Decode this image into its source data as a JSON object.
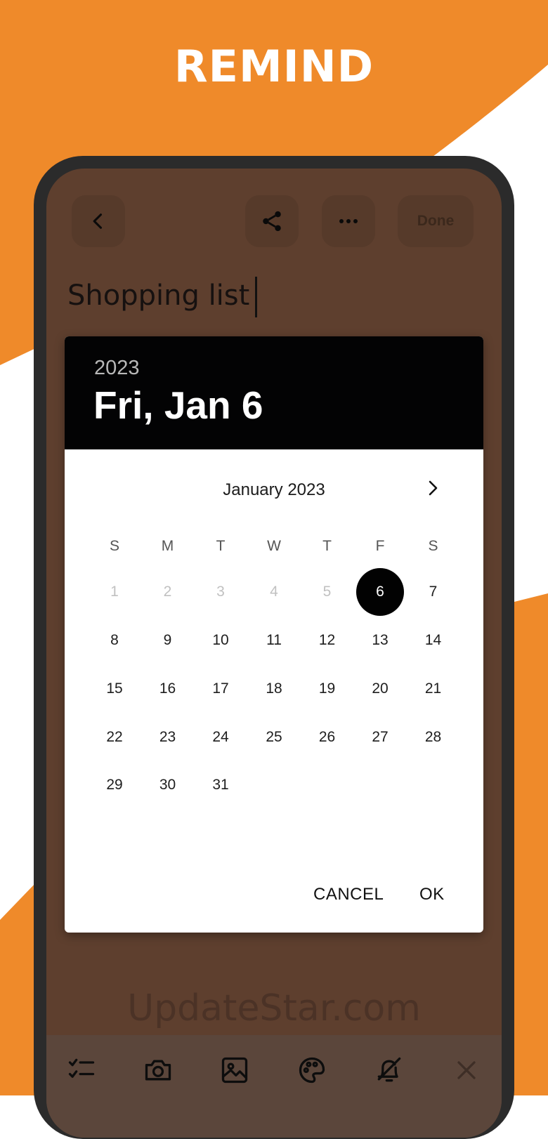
{
  "headline": "REMIND",
  "colors": {
    "brand_orange": "#EF8A2A",
    "screen_brown": "#5E3F2E",
    "selected_day": "#020202"
  },
  "toolbar": {
    "back_icon": "chevron-left-icon",
    "share_icon": "share-icon",
    "more_icon": "more-horizontal-icon",
    "done_label": "Done"
  },
  "note": {
    "title": "Shopping list"
  },
  "date_picker": {
    "year": "2023",
    "selected_date": "Fri, Jan 6",
    "month_label": "January 2023",
    "weekdays": [
      "S",
      "M",
      "T",
      "W",
      "T",
      "F",
      "S"
    ],
    "days": [
      "1",
      "2",
      "3",
      "4",
      "5",
      "6",
      "7",
      "8",
      "9",
      "10",
      "11",
      "12",
      "13",
      "14",
      "15",
      "16",
      "17",
      "18",
      "19",
      "20",
      "21",
      "22",
      "23",
      "24",
      "25",
      "26",
      "27",
      "28",
      "29",
      "30",
      "31"
    ],
    "first_weekday_index": 0,
    "disabled_days": [
      "1",
      "2",
      "3",
      "4",
      "5"
    ],
    "selected_day": "6",
    "cancel_label": "CANCEL",
    "ok_label": "OK"
  },
  "watermark": "UpdateStar.com",
  "bottom_bar": {
    "icons": [
      "checklist-icon",
      "camera-icon",
      "image-icon",
      "palette-icon",
      "reminder-bell-icon",
      "close-icon"
    ]
  }
}
